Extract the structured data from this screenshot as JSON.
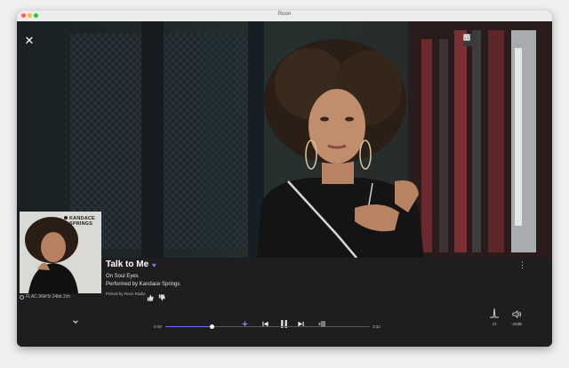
{
  "window": {
    "title": "Roon"
  },
  "toolbar": {
    "buttons": [
      {
        "icon": "person-icon",
        "active": true
      },
      {
        "icon": "album-icon"
      },
      {
        "icon": "lyrics-icon"
      },
      {
        "icon": "cloud-icon"
      },
      {
        "icon": "document-icon"
      },
      {
        "icon": "settings-icon"
      }
    ]
  },
  "now_playing": {
    "title": "Talk to Me",
    "album": "On Soul Eyes",
    "performer": "Performed by Kandace Springs",
    "picked_by": "Picked by Roon Radio",
    "format": "FLAC 96kHz 24bit 2ch",
    "cover_text": "KANDACE SPRINGS",
    "loved": true
  },
  "playback": {
    "elapsed": "0:49",
    "total": "3:32",
    "progress_fraction": 0.23,
    "state": "playing"
  },
  "outputs": {
    "dsp_value": "23",
    "volume": "-20dB"
  },
  "colors": {
    "accent": "#6f6bff",
    "background": "#1e1e20"
  }
}
